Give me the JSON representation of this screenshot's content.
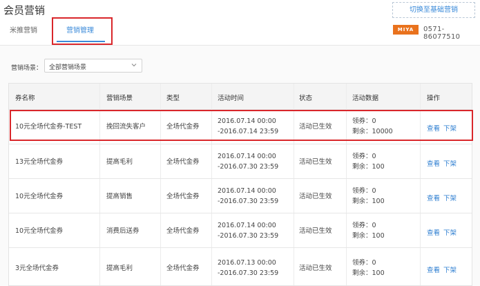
{
  "header": {
    "title": "会员营销",
    "switch_button": "切换至基础营销",
    "phone": "0571-86077510",
    "logo_text": "MIYA"
  },
  "tabs": [
    {
      "label": "米推营销",
      "active": false
    },
    {
      "label": "营销管理",
      "active": true
    }
  ],
  "filter": {
    "label": "营销场景：",
    "selected": "全部营销场景",
    "icon": "chevron-down-icon"
  },
  "table": {
    "headers": [
      "券名称",
      "营销场景",
      "类型",
      "活动时间",
      "状态",
      "活动数据",
      "操作"
    ],
    "rows": [
      {
        "name": "10元全场代金券-TEST",
        "scene": "挽回流失客户",
        "type": "全场代金券",
        "time_start": "2016.07.14 00:00",
        "time_end": "-2016.07.14 23:59",
        "status": "活动已生效",
        "claimed": "领券：0",
        "remaining": "剩余：10000",
        "view": "查看",
        "offline": "下架"
      },
      {
        "name": "13元全场代金券",
        "scene": "提高毛利",
        "type": "全场代金券",
        "time_start": "2016.07.14 00:00",
        "time_end": "-2016.07.30 23:59",
        "status": "活动已生效",
        "claimed": "领券：0",
        "remaining": "剩余：100",
        "view": "查看",
        "offline": "下架"
      },
      {
        "name": "10元全场代金券",
        "scene": "提高销售",
        "type": "全场代金券",
        "time_start": "2016.07.14 00:00",
        "time_end": "-2016.07.30 23:59",
        "status": "活动已生效",
        "claimed": "领券：0",
        "remaining": "剩余：100",
        "view": "查看",
        "offline": "下架"
      },
      {
        "name": "10元全场代金券",
        "scene": "消费后送券",
        "type": "全场代金券",
        "time_start": "2016.07.14 00:00",
        "time_end": "-2016.07.30 23:59",
        "status": "活动已生效",
        "claimed": "领券：0",
        "remaining": "剩余：100",
        "view": "查看",
        "offline": "下架"
      },
      {
        "name": "3元全场代金券",
        "scene": "提高毛利",
        "type": "全场代金券",
        "time_start": "2016.07.13 00:00",
        "time_end": "-2016.07.30 23:59",
        "status": "活动已生效",
        "claimed": "领券：0",
        "remaining": "剩余：100",
        "view": "查看",
        "offline": "下架"
      }
    ]
  },
  "colors": {
    "accent": "#3a8ad9",
    "highlight": "#d9262a",
    "brand": "#e9721d"
  }
}
